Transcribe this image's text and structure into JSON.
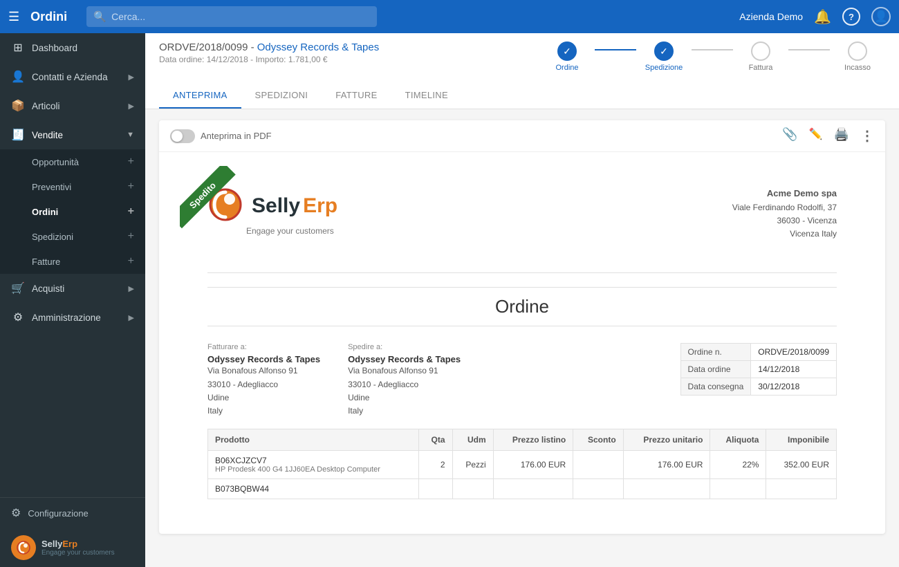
{
  "topbar": {
    "menu_label": "☰",
    "title": "Ordini",
    "search_placeholder": "Cerca...",
    "company": "Azienda Demo",
    "bell_icon": "🔔",
    "help_icon": "?",
    "user_icon": "👤"
  },
  "sidebar": {
    "items": [
      {
        "id": "dashboard",
        "label": "Dashboard",
        "icon": "⊞",
        "has_arrow": false
      },
      {
        "id": "contatti",
        "label": "Contatti e Azienda",
        "icon": "👤",
        "has_arrow": true
      },
      {
        "id": "articoli",
        "label": "Articoli",
        "icon": "📦",
        "has_arrow": true
      },
      {
        "id": "vendite",
        "label": "Vendite",
        "icon": "🧾",
        "has_arrow": true,
        "active": true
      }
    ],
    "vendite_subitems": [
      {
        "id": "opportunita",
        "label": "Opportunità",
        "add": true
      },
      {
        "id": "preventivi",
        "label": "Preventivi",
        "add": true
      },
      {
        "id": "ordini",
        "label": "Ordini",
        "add": true,
        "active": true
      },
      {
        "id": "spedizioni",
        "label": "Spedizioni",
        "add": true
      },
      {
        "id": "fatture",
        "label": "Fatture",
        "add": true
      }
    ],
    "bottom_items": [
      {
        "id": "acquisti",
        "label": "Acquisti",
        "icon": "🛒",
        "has_arrow": true
      },
      {
        "id": "amministrazione",
        "label": "Amministrazione",
        "icon": "⚙",
        "has_arrow": true
      }
    ],
    "config_label": "Configurazione",
    "logo_text": "SellyErp",
    "logo_tagline": "Engage your customers"
  },
  "order": {
    "id": "ORDVE/2018/0099",
    "customer": "Odyssey Records & Tapes",
    "date_label": "Data ordine:",
    "date": "14/12/2018",
    "amount_label": "Importo:",
    "amount": "1.781,00 €"
  },
  "progress": {
    "steps": [
      {
        "id": "ordine",
        "label": "Ordine",
        "done": true
      },
      {
        "id": "spedizione",
        "label": "Spedizione",
        "done": true
      },
      {
        "id": "fattura",
        "label": "Fattura",
        "done": false
      },
      {
        "id": "incasso",
        "label": "Incasso",
        "done": false
      }
    ]
  },
  "tabs": [
    {
      "id": "anteprima",
      "label": "ANTEPRIMA",
      "active": true
    },
    {
      "id": "spedizioni",
      "label": "SPEDIZIONI",
      "active": false
    },
    {
      "id": "fatture",
      "label": "FATTURE",
      "active": false
    },
    {
      "id": "timeline",
      "label": "TIMELINE",
      "active": false
    }
  ],
  "preview": {
    "toggle_label": "Anteprima in PDF",
    "attach_icon": "📎",
    "edit_icon": "✏",
    "print_icon": "🖨",
    "more_icon": "⋮",
    "banner": "Spedito"
  },
  "document": {
    "logo_selly": "Selly",
    "logo_erp": "Erp",
    "logo_tagline": "Engage your customers",
    "company_name": "Acme Demo spa",
    "company_address": "Viale Ferdinando Rodolfi, 37",
    "company_city": "36030 - Vicenza",
    "company_country": "Vicenza Italy",
    "doc_title": "Ordine",
    "bill_to_label": "Fatturare a:",
    "bill_to_name": "Odyssey Records & Tapes",
    "bill_to_address": "Via Bonafous Alfonso 91",
    "bill_to_city": "33010 - Adegliacco",
    "bill_to_region": "Udine",
    "bill_to_country": "Italy",
    "ship_to_label": "Spedire a:",
    "ship_to_name": "Odyssey Records & Tapes",
    "ship_to_address": "Via Bonafous Alfonso 91",
    "ship_to_city": "33010 - Adegliacco",
    "ship_to_region": "Udine",
    "ship_to_country": "Italy",
    "order_number_label": "Ordine n.",
    "order_number": "ORDVE/2018/0099",
    "order_date_label": "Data ordine",
    "order_date": "14/12/2018",
    "delivery_date_label": "Data consegna",
    "delivery_date": "30/12/2018",
    "table_headers": {
      "product": "Prodotto",
      "qty": "Qta",
      "udm": "Udm",
      "list_price": "Prezzo listino",
      "discount": "Sconto",
      "unit_price": "Prezzo unitario",
      "tax": "Aliquota",
      "taxable": "Imponibile"
    },
    "products": [
      {
        "code": "B06XCJZCV7",
        "name": "HP Prodesk 400 G4 1JJ60EA Desktop Computer",
        "qty": "2",
        "udm": "Pezzi",
        "list_price": "176.00 EUR",
        "discount": "",
        "unit_price": "176.00 EUR",
        "tax": "22%",
        "taxable": "352.00 EUR"
      },
      {
        "code": "B073BQBW44",
        "name": "",
        "qty": "",
        "udm": "",
        "list_price": "",
        "discount": "",
        "unit_price": "",
        "tax": "",
        "taxable": ""
      }
    ]
  }
}
